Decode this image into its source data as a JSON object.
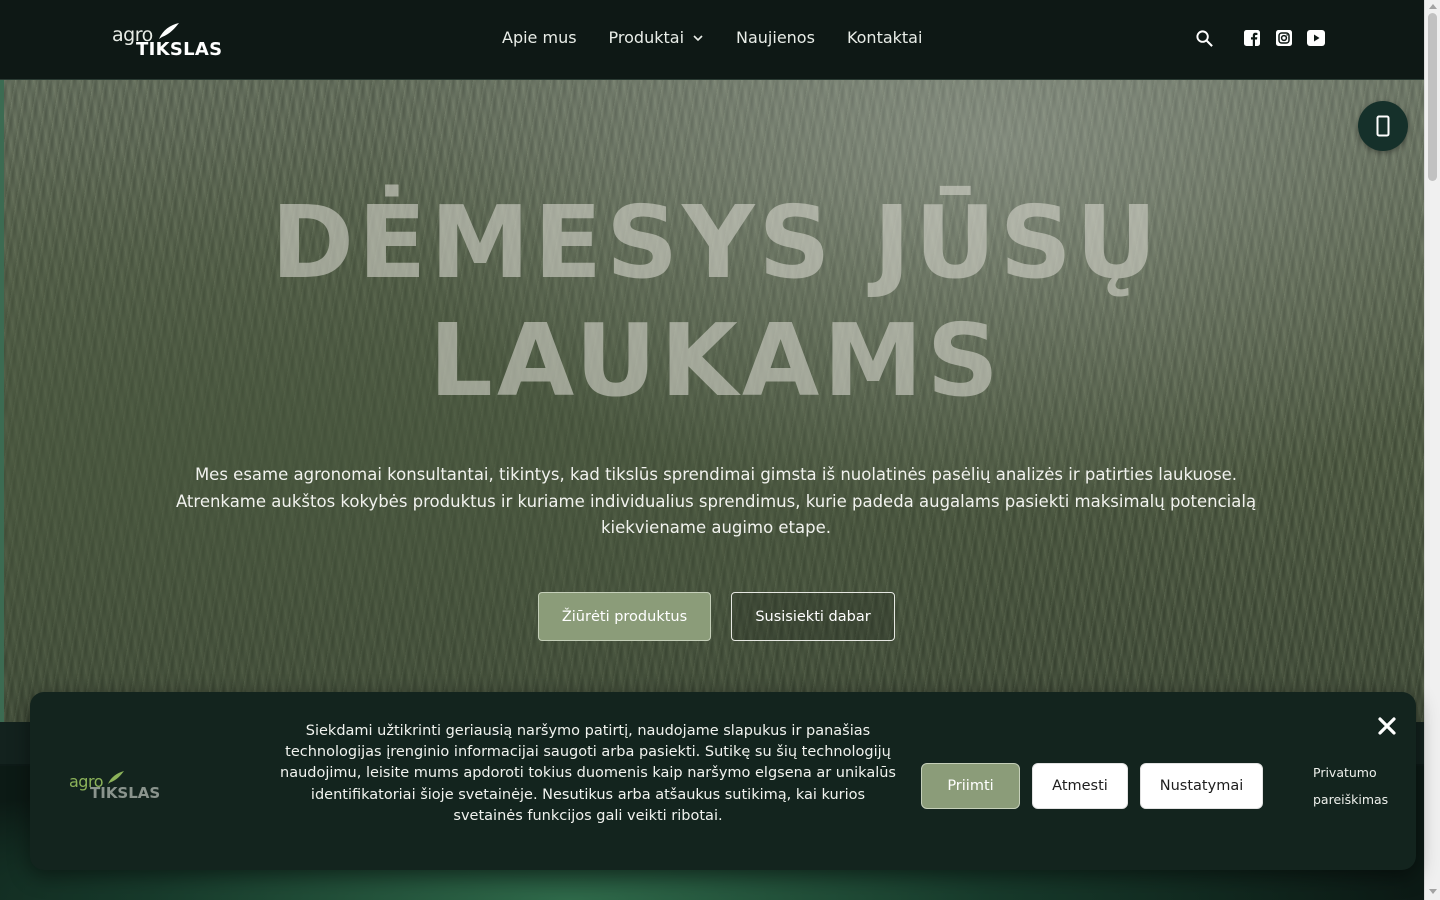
{
  "header": {
    "logo": {
      "top": "agro",
      "bottom": "TIKSLAS"
    },
    "nav": [
      {
        "label": "Apie mus"
      },
      {
        "label": "Produktai",
        "has_dropdown": true
      },
      {
        "label": "Naujienos"
      },
      {
        "label": "Kontaktai"
      }
    ],
    "icons": [
      "search-icon",
      "facebook-icon",
      "instagram-icon",
      "youtube-icon"
    ]
  },
  "hero": {
    "title_line1": "DĖMESYS JŪSŲ",
    "title_line2": "LAUKAMS",
    "text_line1": "Mes esame agronomai konsultantai, tikintys, kad tikslūs sprendimai gimsta iš nuolatinės pasėlių analizės ir patirties laukuose.",
    "text_line2": "Atrenkame aukštos kokybės produktus ir kuriame individualius sprendimus, kurie padeda augalams pasiekti maksimalų potencialą kiekviename augimo etape.",
    "primary_button": "Žiūrėti produktus",
    "secondary_button": "Susisiekti dabar",
    "floating_icon": "phone-icon"
  },
  "cookie_banner": {
    "logo": {
      "top": "agro",
      "bottom": "TIKSLAS"
    },
    "text": "Siekdami užtikrinti geriausią naršymo patirtį, naudojame slapukus ir panašias technologijas įrenginio informacijai saugoti arba pasiekti. Sutikę su šių technologijų naudojimu, leisite mums apdoroti tokius duomenis kaip naršymo elgsena ar unikalūs identifikatoriai šioje svetainėje. Nesutikus arba atšaukus sutikimą, kai kurios svetainės funkcijos gali veikti ribotai.",
    "accept": "Priimti",
    "reject": "Atmesti",
    "settings": "Nustatymai",
    "privacy_line1": "Privatumo",
    "privacy_line2": "pareiškimas",
    "close_icon": "close-icon"
  },
  "colors": {
    "header_bg": "#0e1815",
    "accent_green": "#8b9c79",
    "banner_bg": "#13241e",
    "logo_green": "#8cb35a"
  }
}
